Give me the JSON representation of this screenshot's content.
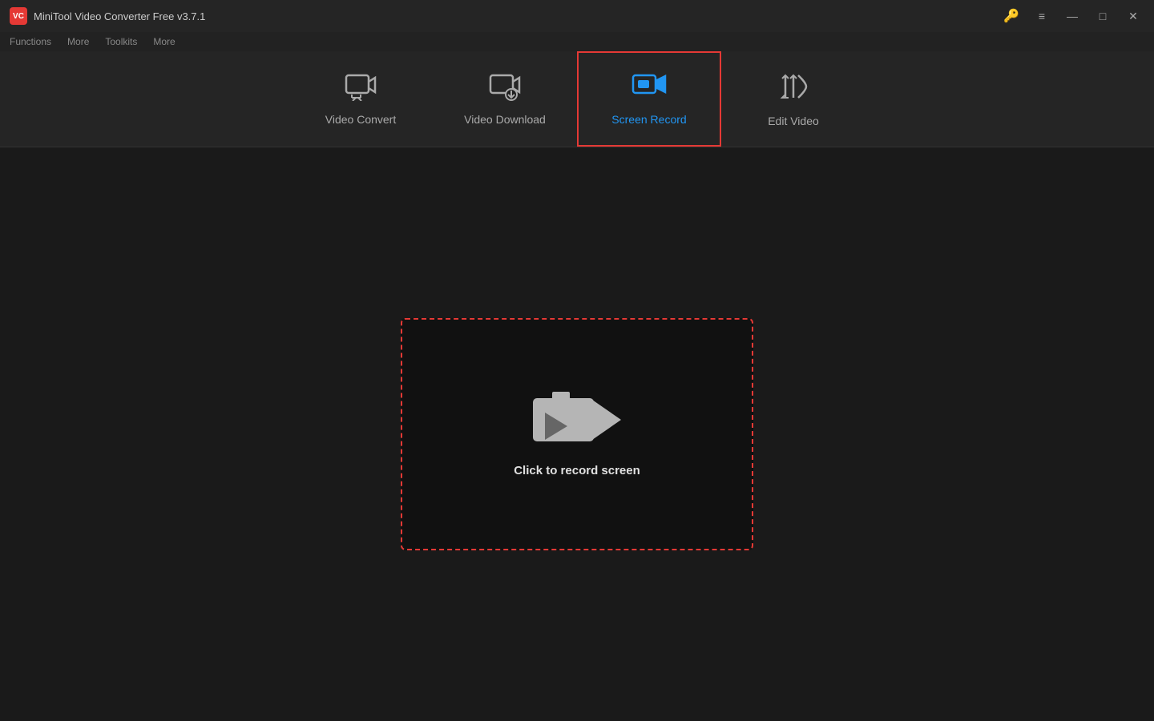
{
  "app": {
    "title": "MiniTool Video Converter Free v3.7.1",
    "logo_text": "VC"
  },
  "menu": {
    "items": [
      "Functions",
      "More",
      "Toolkits",
      "More"
    ]
  },
  "nav": {
    "tabs": [
      {
        "id": "video-convert",
        "label": "Video Convert",
        "active": false
      },
      {
        "id": "video-download",
        "label": "Video Download",
        "active": false
      },
      {
        "id": "screen-record",
        "label": "Screen Record",
        "active": true
      },
      {
        "id": "edit-video",
        "label": "Edit Video",
        "active": false
      }
    ]
  },
  "main": {
    "record_prompt": "Click to record screen"
  },
  "titlebar": {
    "minimize": "—",
    "maximize": "□",
    "close": "✕"
  },
  "colors": {
    "active_tab_border": "#e53935",
    "active_tab_text": "#2196F3",
    "record_border": "#e53935"
  }
}
